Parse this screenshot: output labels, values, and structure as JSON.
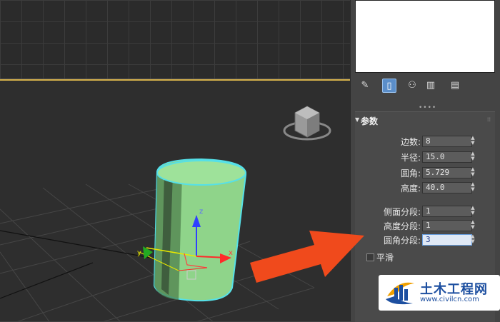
{
  "panel": {
    "toolbar": [
      {
        "icon": "pin-icon"
      },
      {
        "icon": "modifier-stack-icon",
        "active": true
      },
      {
        "icon": "graph-icon"
      },
      {
        "icon": "trash-icon"
      },
      {
        "icon": "configure-icon"
      }
    ],
    "rollout_title": "参数",
    "params_group1": [
      {
        "label": "边数:",
        "value": "8"
      },
      {
        "label": "半径:",
        "value": "15.0"
      },
      {
        "label": "圆角:",
        "value": "5.729"
      },
      {
        "label": "高度:",
        "value": "40.0"
      }
    ],
    "params_group2": [
      {
        "label": "侧面分段:",
        "value": "1"
      },
      {
        "label": "高度分段:",
        "value": "1"
      },
      {
        "label": "圆角分段:",
        "value": "3"
      }
    ],
    "smooth_label": "平滑"
  },
  "viewport": {
    "gizmo_z_label": "z",
    "gizmo_y_label": "y",
    "gizmo_x_label": "x",
    "object_color": "#8fd48a",
    "selection_color": "#55e0e8"
  },
  "watermark": {
    "title": "土木工程网",
    "url": "www.civilcn.com"
  },
  "colors": {
    "accent": "#5b8ec9",
    "arrow": "#f04a1c",
    "viewport_border": "#d4b04a"
  }
}
